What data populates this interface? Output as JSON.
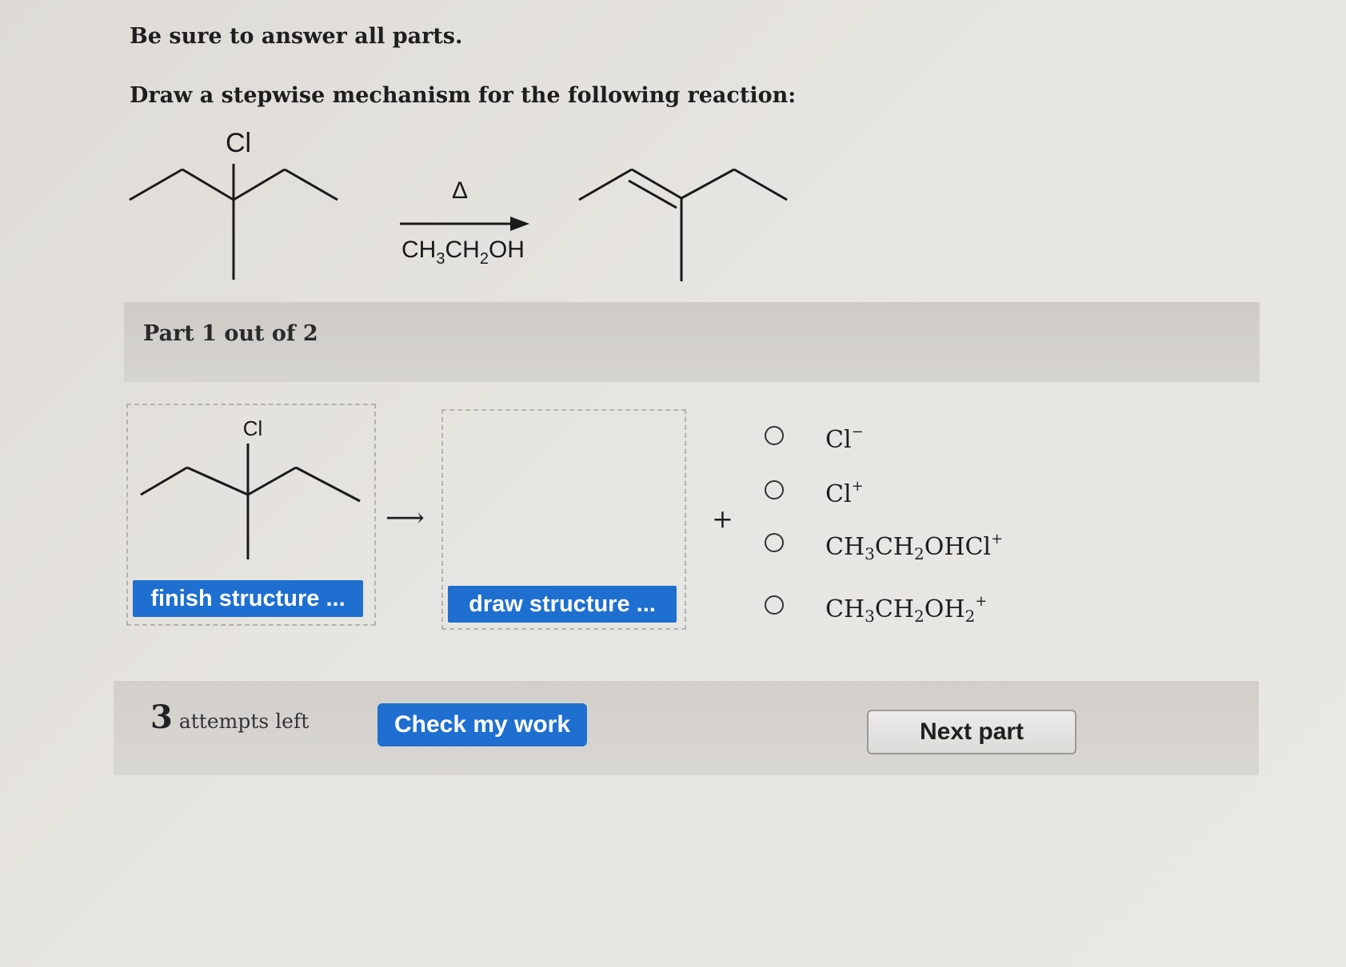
{
  "instructions": {
    "line1": "Be sure to answer all parts.",
    "line2": "Draw a stepwise mechanism for the following reaction:"
  },
  "reaction": {
    "reactant_label": "Cl",
    "condition_top": "Δ",
    "condition_bottom": {
      "c1": "CH",
      "s1": "3",
      "c2": "CH",
      "s2": "2",
      "c3": "OH"
    }
  },
  "part": {
    "label": "Part 1 out of 2"
  },
  "workspace": {
    "structure_label": "Cl",
    "finish_button": "finish structure ...",
    "draw_button": "draw structure ...",
    "arrow": "⟶",
    "plus": "+"
  },
  "options": [
    {
      "p1": "Cl",
      "sup": "−"
    },
    {
      "p1": "Cl",
      "sup": "+"
    },
    {
      "p1": "CH",
      "s1": "3",
      "p2": "CH",
      "s2": "2",
      "p3": "OHCl",
      "sup": "+"
    },
    {
      "p1": "CH",
      "s1": "3",
      "p2": "CH",
      "s2": "2",
      "p3": "OH",
      "s3": "2",
      "sup": "+"
    }
  ],
  "footer": {
    "attempts_count": "3",
    "attempts_text": "attempts left",
    "check_button": "Check my work",
    "next_button": "Next part"
  }
}
